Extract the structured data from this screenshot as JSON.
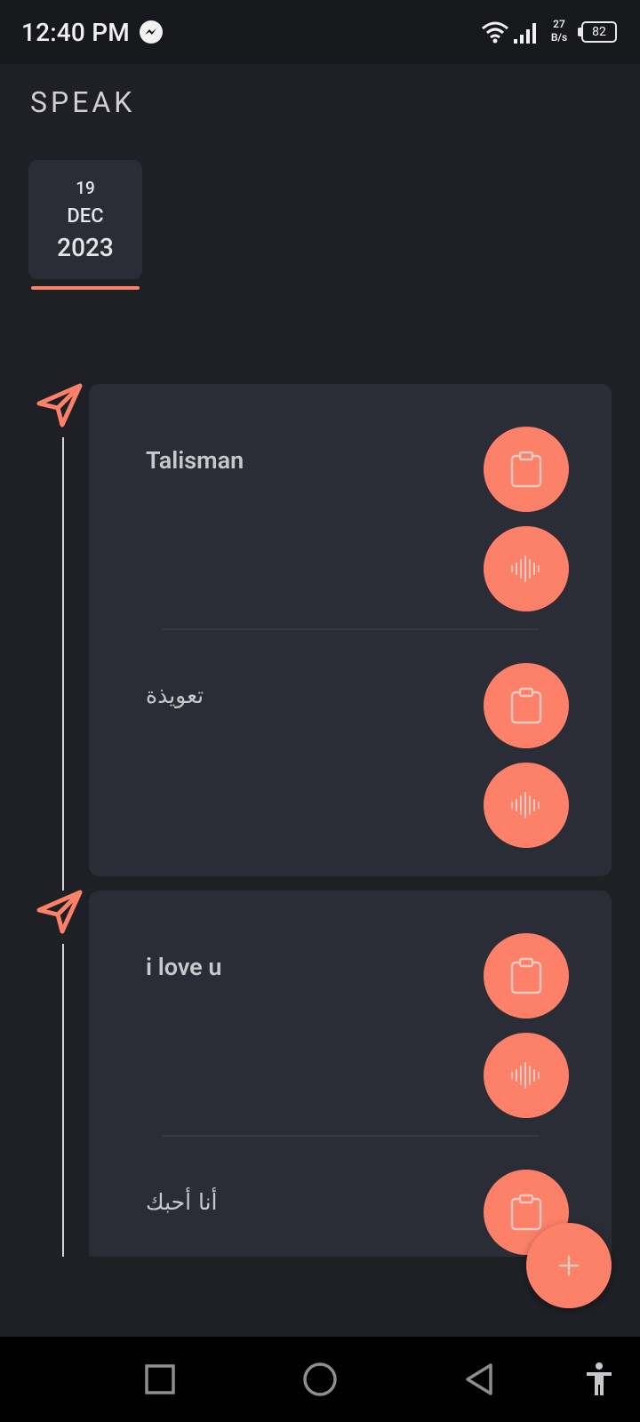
{
  "status_bar": {
    "time": "12:40 PM",
    "net_speed_value": "27",
    "net_speed_unit": "B/s",
    "battery": "82",
    "icons": [
      "messenger-icon",
      "wifi-icon",
      "signal-icon",
      "battery-icon"
    ]
  },
  "app": {
    "title": "SPEAK"
  },
  "date_tab": {
    "day": "19",
    "month": "DEC",
    "year": "2023"
  },
  "entries": [
    {
      "source_text": "Talisman",
      "translated_text": "تعويذة"
    },
    {
      "source_text": "i love u",
      "translated_text": "أنا أحبك"
    }
  ],
  "buttons": {
    "copy_icon": "clipboard-icon",
    "speak_icon": "sound-wave-icon",
    "add_icon": "plus-icon"
  },
  "nav_bar": {
    "items": [
      "recents-square-icon",
      "home-circle-icon",
      "back-triangle-icon",
      "accessibility-icon"
    ]
  },
  "colors": {
    "accent": "#fd8168",
    "background": "#1f2026",
    "card": "#2a2d35",
    "status_bar": "#17181c",
    "nav_bar": "#000000"
  }
}
